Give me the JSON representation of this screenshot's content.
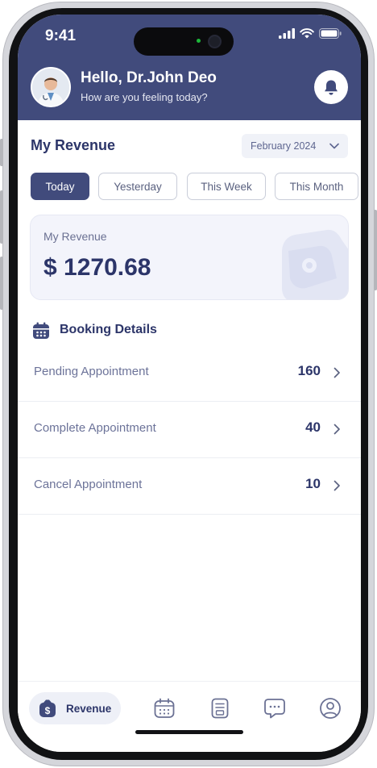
{
  "status_bar": {
    "time": "9:41"
  },
  "header": {
    "greeting": "Hello, Dr.John Deo",
    "subtitle": "How are you feeling today?",
    "bell_icon": "bell-icon"
  },
  "revenue_section": {
    "title": "My Revenue",
    "month_selected": "February 2024",
    "tabs": [
      {
        "label": "Today",
        "active": true
      },
      {
        "label": "Yesterday",
        "active": false
      },
      {
        "label": "This Week",
        "active": false
      },
      {
        "label": "This Month",
        "active": false
      }
    ],
    "card": {
      "label": "My Revenue",
      "amount": "$ 1270.68"
    }
  },
  "booking": {
    "title": "Booking Details",
    "rows": [
      {
        "label": "Pending Appointment",
        "count": "160"
      },
      {
        "label": "Complete Appointment",
        "count": "40"
      },
      {
        "label": "Cancel Appointment",
        "count": "10"
      }
    ]
  },
  "bottom_nav": {
    "active_label": "Revenue",
    "items": [
      "revenue-icon",
      "calendar-icon",
      "document-icon",
      "chat-icon",
      "profile-icon"
    ]
  },
  "colors": {
    "primary": "#414b7c",
    "title": "#2c3569",
    "muted": "#6c7399"
  }
}
